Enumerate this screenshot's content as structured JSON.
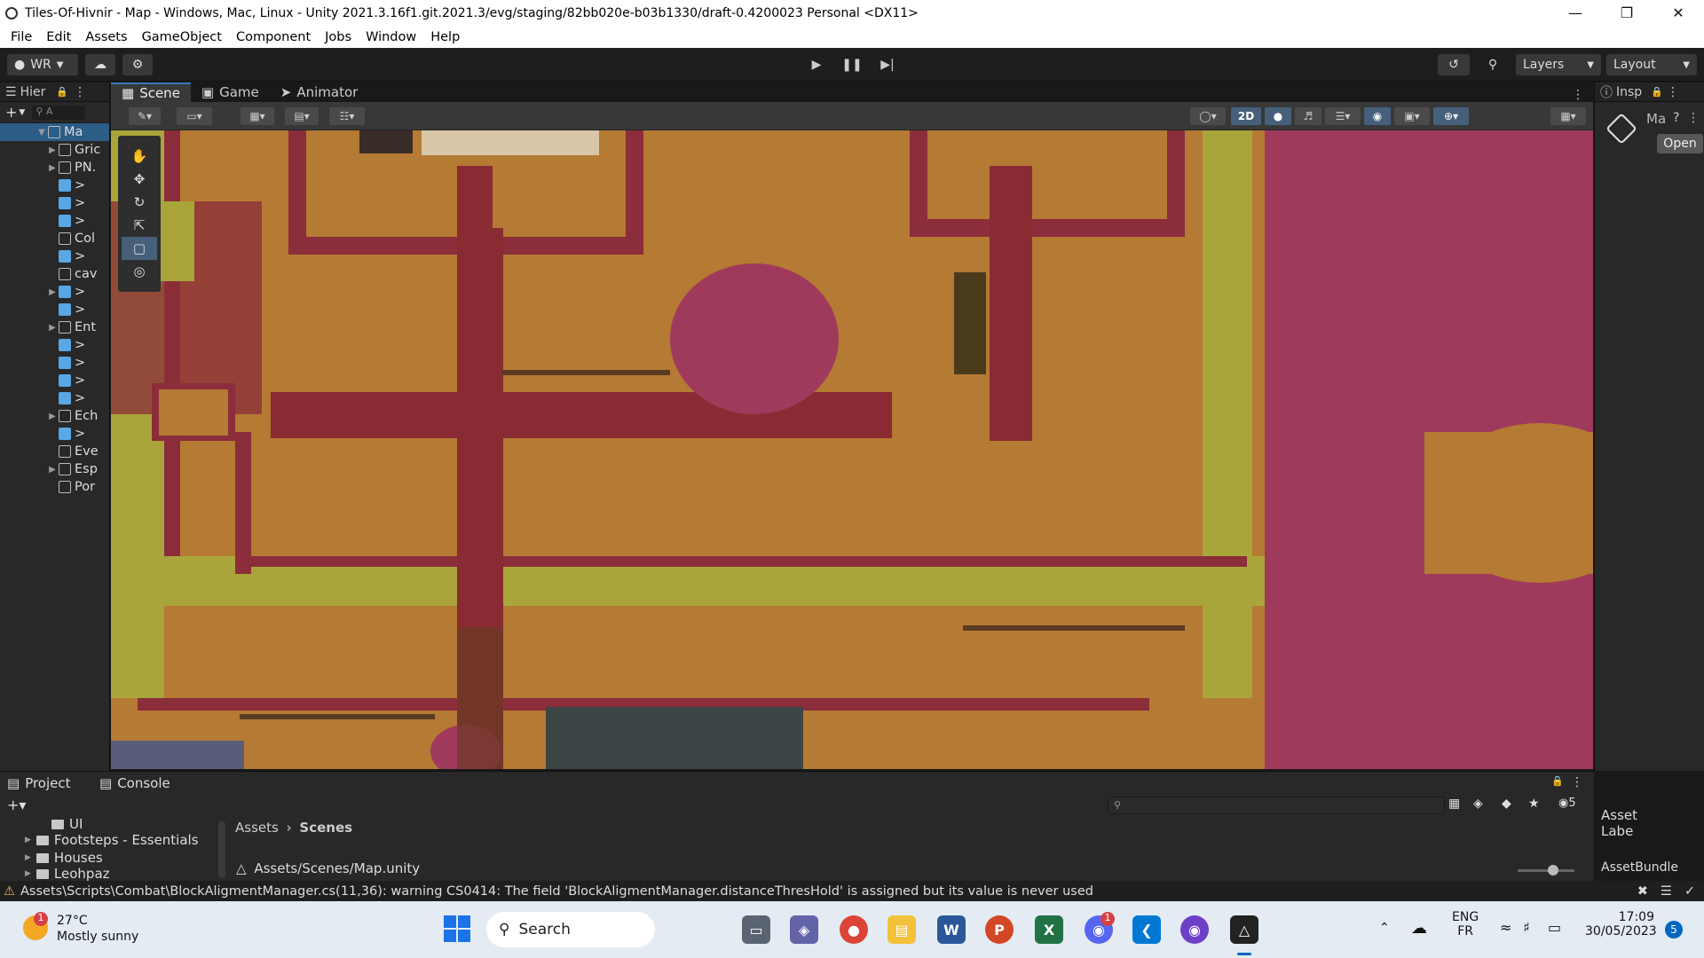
{
  "window": {
    "title": "Tiles-Of-Hivnir - Map - Windows, Mac, Linux - Unity 2021.3.16f1.git.2021.3/evg/staging/82bb020e-b03b1330/draft-0.4200023 Personal <DX11>"
  },
  "menu": [
    "File",
    "Edit",
    "Assets",
    "GameObject",
    "Component",
    "Jobs",
    "Window",
    "Help"
  ],
  "toolbar": {
    "account": "WR",
    "layers": "Layers",
    "layout": "Layout"
  },
  "hierarchy": {
    "tab": "Hier",
    "search_placeholder": "A",
    "root": "Ma",
    "items": [
      "Gric",
      "PN.",
      ">",
      ">",
      ">",
      "Col",
      ">",
      "cav",
      ">",
      ">",
      "Ent",
      ">",
      ">",
      ">",
      ">",
      "Ech",
      ">",
      "Eve",
      "Esp",
      "Por"
    ]
  },
  "scene_tabs": [
    "Scene",
    "Game",
    "Animator"
  ],
  "scene_toolbar": {
    "mode_2d": "2D"
  },
  "inspector": {
    "tab": "Insp",
    "object_label": "Ma",
    "open_button": "Open",
    "asset_labels": "Asset Labe",
    "asset_bundle": "AssetBundle"
  },
  "project": {
    "tabs": [
      "Project",
      "Console"
    ],
    "folders": [
      "UI",
      "Footsteps - Essentials",
      "Houses",
      "Leohpaz"
    ],
    "breadcrumb": [
      "Assets",
      "Scenes"
    ],
    "selected_path": "Assets/Scenes/Map.unity",
    "hidden_count": "5"
  },
  "status": {
    "warning": "Assets\\Scripts\\Combat\\BlockAligmentManager.cs(11,36): warning CS0414: The field 'BlockAligmentManager.distanceThresHold' is assigned but its value is never used"
  },
  "taskbar": {
    "weather_temp": "27°C",
    "weather_desc": "Mostly sunny",
    "weather_badge": "1",
    "search": "Search",
    "lang_1": "ENG",
    "lang_2": "FR",
    "time": "17:09",
    "date": "30/05/2023",
    "notif": "5",
    "discord_badge": "1"
  },
  "colors": {
    "grass": "#b57a33",
    "path": "#8a2a33",
    "trees": "#a03a5c",
    "border_grass": "#aaa53a"
  }
}
